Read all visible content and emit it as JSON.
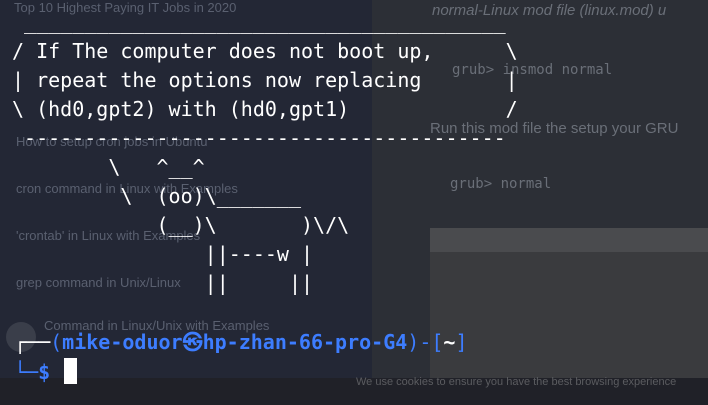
{
  "background": {
    "left_items": [
      "Top 10 Highest Paying IT Jobs in 2020",
      "How to setup cron jobs in Ubuntu",
      "cron command in Linux with Examples",
      "'crontab' in Linux with Examples",
      "grep command in Unix/Linux",
      "Command in Linux/Unix with Examples"
    ],
    "right_lines": [
      "normal-Linux mod file (linux.mod) u",
      "grub> insmod normal",
      "Run this mod file the setup your GRU",
      "grub> normal"
    ],
    "cookie_text": "We use cookies to ensure you have the best browsing experience"
  },
  "terminal": {
    "ascii_art": " ________________________________________\n/ If The computer does not boot up,      \\\n| repeat the options now replacing       |\n\\ (hd0,gpt2) with (hd0,gpt1)             /\n ----------------------------------------\n        \\   ^__^\n         \\  (oo)\\_______\n            (__)\\       )\\/\\\n                ||----w |\n                ||     ||",
    "prompt": {
      "corner_top": "┌──",
      "open_paren": "(",
      "user": "mike-oduor",
      "at_symbol": "㉿",
      "host": "hp-zhan-66-pro-G4",
      "close_paren": ")-[",
      "path": "~",
      "close_bracket": "]",
      "corner_bottom": "└─",
      "symbol": "$"
    }
  },
  "colors": {
    "prompt_blue": "#3d7dff",
    "text_white": "#ffffff",
    "background": "#1b1e27"
  }
}
